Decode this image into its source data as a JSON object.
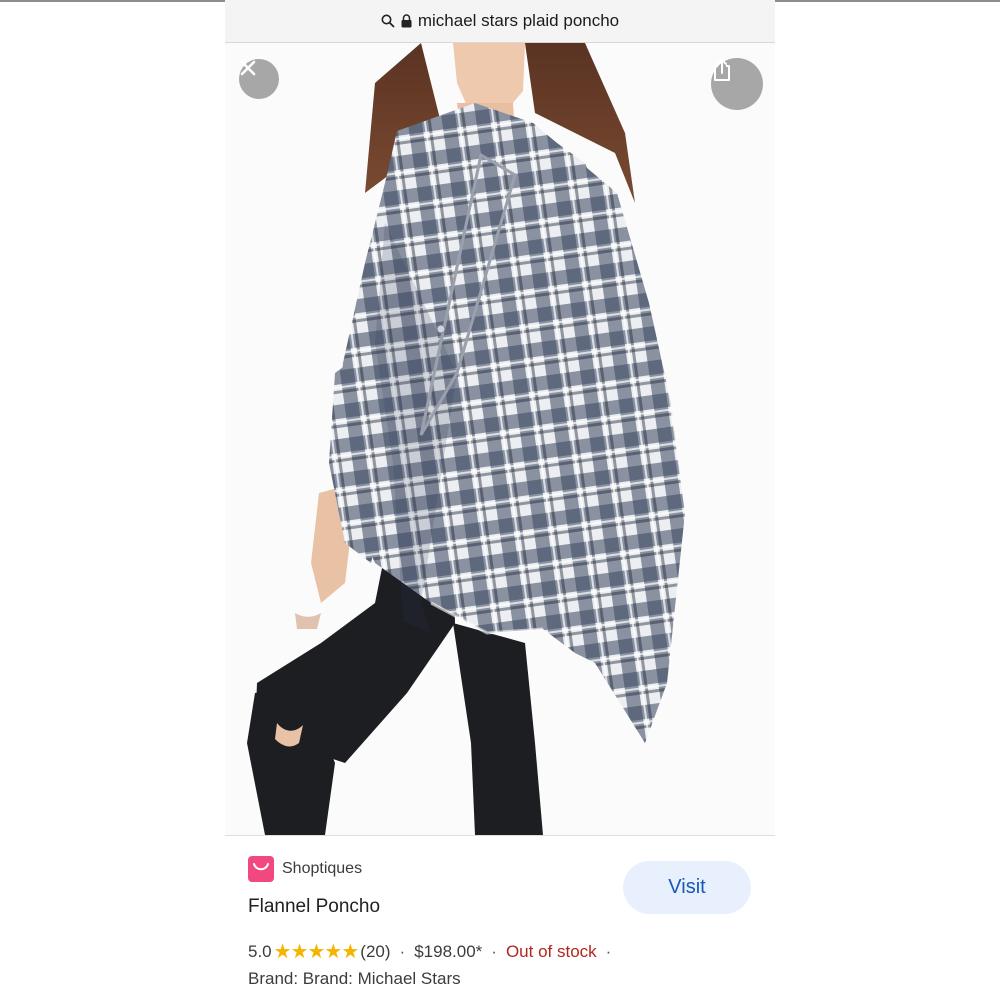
{
  "browser": {
    "search_query": "michael stars plaid poncho"
  },
  "result": {
    "merchant": "Shoptiques",
    "title": "Flannel Poncho",
    "visit_label": "Visit",
    "rating": "5.0",
    "stars_text": "★★★★★",
    "review_count": "(20)",
    "price": "$198.00*",
    "availability": "Out of stock",
    "separator": "·",
    "brand_line": "Brand: Brand: Michael Stars"
  },
  "colors": {
    "merchant_icon": "#f0487f",
    "visit_button_bg": "#e8f0fe",
    "visit_button_text": "#1a57b8",
    "star": "#f4b400",
    "out_of_stock": "#b3261e"
  },
  "icons": {
    "close": "close-icon",
    "share": "share-icon",
    "search": "search-icon",
    "lock": "lock-icon",
    "merchant": "shopping-bag-icon"
  }
}
